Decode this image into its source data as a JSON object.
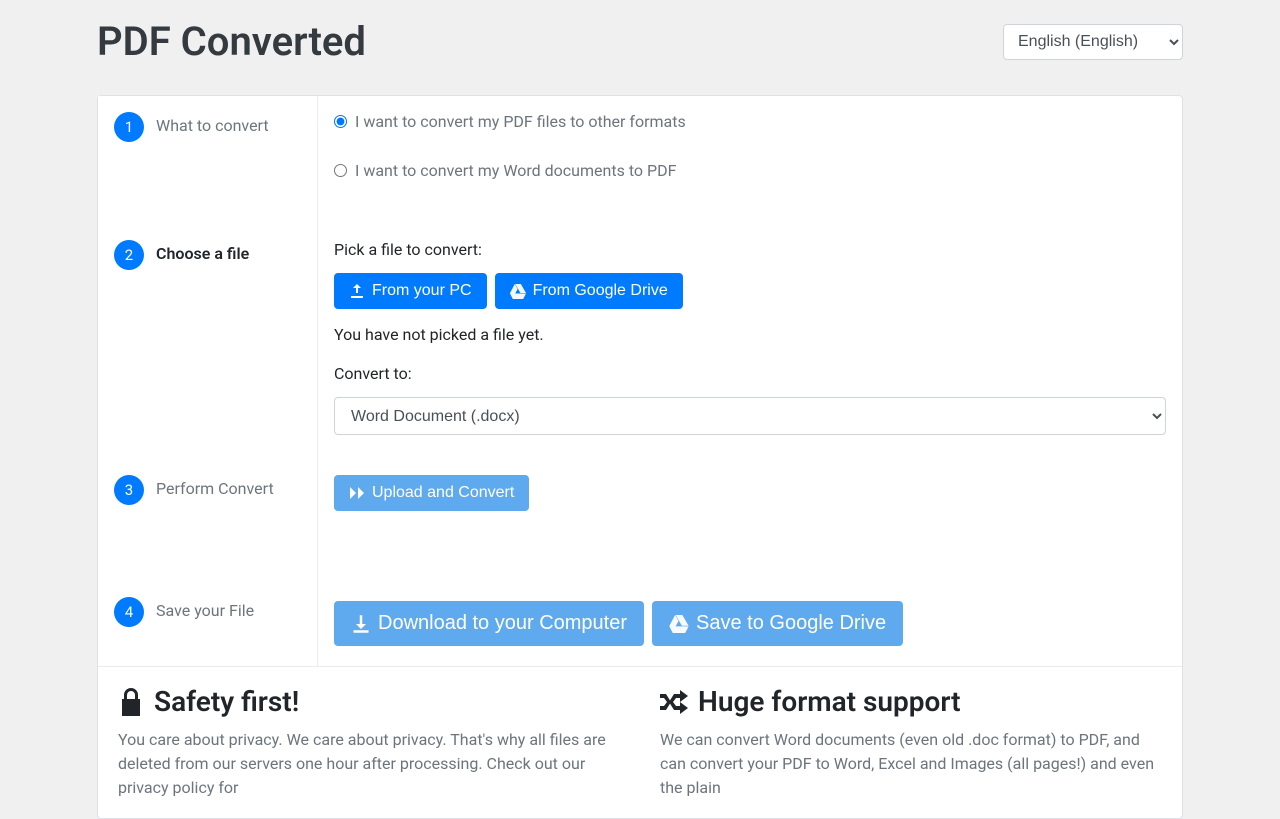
{
  "header": {
    "title": "PDF Converted",
    "language_selected": "English (English)"
  },
  "steps": {
    "step1": {
      "number": "1",
      "title": "What to convert",
      "option_pdf": "I want to convert my PDF files to other formats",
      "option_word": "I want to convert my Word documents to PDF"
    },
    "step2": {
      "number": "2",
      "title": "Choose a file",
      "pick_label": "Pick a file to convert:",
      "from_pc": "From your PC",
      "from_drive": "From Google Drive",
      "status": "You have not picked a file yet.",
      "convert_to_label": "Convert to:",
      "convert_to_selected": "Word Document (.docx)"
    },
    "step3": {
      "number": "3",
      "title": "Perform Convert",
      "button": "Upload and Convert"
    },
    "step4": {
      "number": "4",
      "title": "Save your File",
      "download": "Download to your Computer",
      "save_drive": "Save to Google Drive"
    }
  },
  "info": {
    "safety": {
      "title": "Safety first!",
      "body": "You care about privacy. We care about privacy. That's why all files are deleted from our servers one hour after processing. Check out our privacy policy for"
    },
    "formats": {
      "title": "Huge format support",
      "body": "We can convert Word documents (even old .doc format) to PDF, and can convert your PDF to Word, Excel and Images (all pages!) and even the plain"
    }
  }
}
